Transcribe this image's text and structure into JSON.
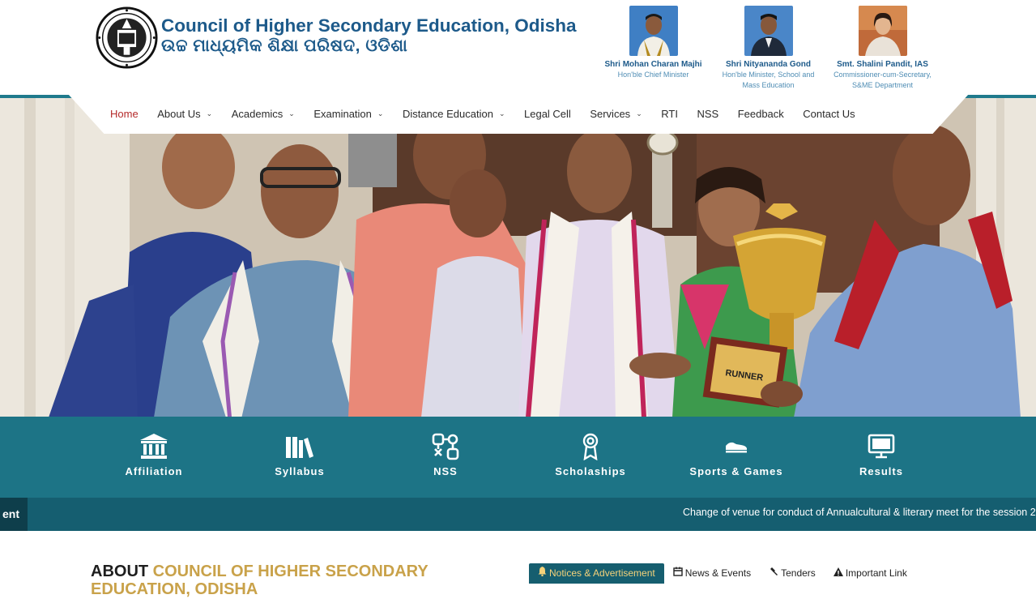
{
  "header": {
    "title_en": "Council of Higher Secondary Education, Odisha",
    "title_or": "ଉଚ୍ଚ ମାଧ୍ୟମିକ ଶିକ୍ଷା ପରିଷଦ, ଓଡିଶା",
    "officials": [
      {
        "name": "Shri Mohan Charan Majhi",
        "role": "Hon'ble Chief Minister"
      },
      {
        "name": "Shri Nityananda Gond",
        "role": "Hon'ble Minister, School and Mass Education"
      },
      {
        "name": "Smt. Shalini Pandit, IAS",
        "role": "Commissioner-cum-Secretary, S&ME Department"
      }
    ]
  },
  "nav": {
    "items": [
      {
        "label": "Home",
        "active": true,
        "dropdown": false
      },
      {
        "label": "About Us",
        "dropdown": true
      },
      {
        "label": "Academics",
        "dropdown": true
      },
      {
        "label": "Examination",
        "dropdown": true
      },
      {
        "label": "Distance Education",
        "dropdown": true
      },
      {
        "label": "Legal Cell",
        "dropdown": false
      },
      {
        "label": "Services",
        "dropdown": true
      },
      {
        "label": "RTI",
        "dropdown": false
      },
      {
        "label": "NSS",
        "dropdown": false
      },
      {
        "label": "Feedback",
        "dropdown": false
      },
      {
        "label": "Contact Us",
        "dropdown": false
      }
    ],
    "caret": "⌄"
  },
  "hero": {
    "trophy_plaque_text": "RUNNER"
  },
  "quick_links": [
    {
      "label": "Affiliation",
      "icon": "institution-icon"
    },
    {
      "label": "Syllabus",
      "icon": "books-icon"
    },
    {
      "label": "NSS",
      "icon": "nss-icon"
    },
    {
      "label": "Scholaships",
      "icon": "award-ribbon-icon"
    },
    {
      "label": "Sports & Games",
      "icon": "sneaker-icon"
    },
    {
      "label": "Results",
      "icon": "monitor-icon"
    }
  ],
  "ticker": {
    "tag_label": "ent",
    "message": "Change of venue for conduct of Annualcultural & literary meet for the session 2"
  },
  "about": {
    "heading_part1": "ABOUT",
    "heading_part2": "COUNCIL OF HIGHER SECONDARY",
    "heading_line2": "EDUCATION, ODISHA"
  },
  "tabs": [
    {
      "label": "Notices & Advertisement",
      "icon": "bell-icon",
      "active": true
    },
    {
      "label": "News & Events",
      "icon": "calendar-icon"
    },
    {
      "label": "Tenders",
      "icon": "gavel-icon"
    },
    {
      "label": "Important Link",
      "icon": "warning-icon"
    }
  ],
  "colors": {
    "brand_blue": "#1d5a8a",
    "teal_band": "#1d7486",
    "ticker_bg": "#155e70",
    "active_nav": "#b52a2a",
    "gold": "#c9a24a"
  }
}
